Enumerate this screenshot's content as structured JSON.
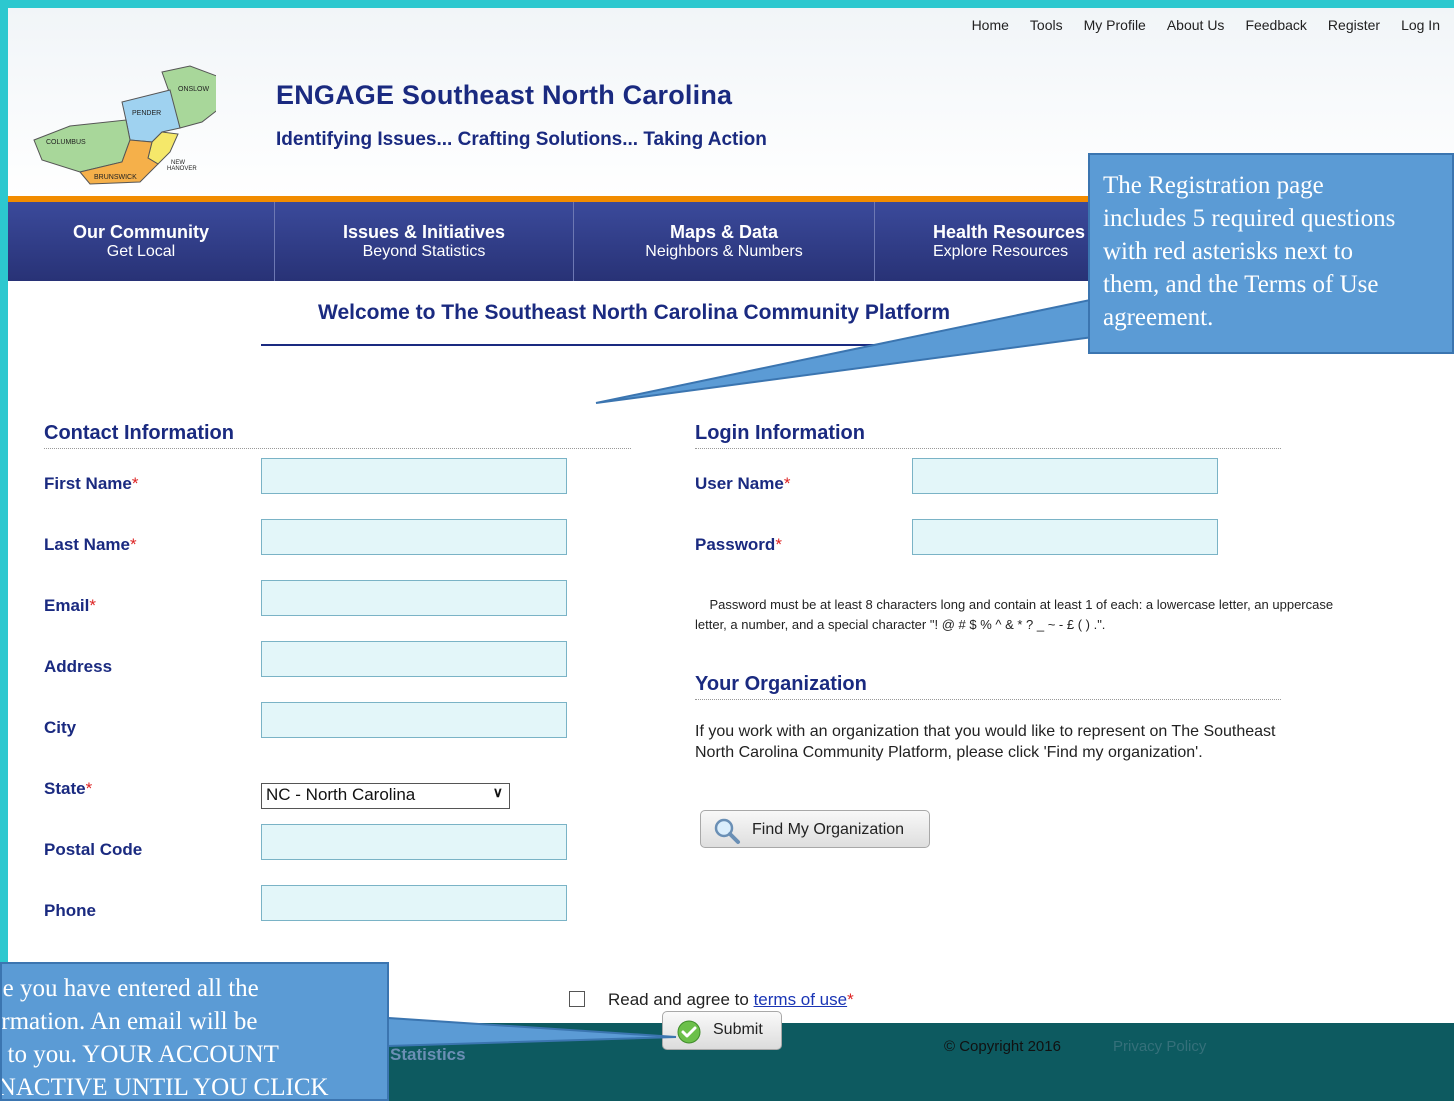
{
  "top_nav": [
    "Home",
    "Tools",
    "My Profile",
    "About Us",
    "Feedback",
    "Register",
    "Log In"
  ],
  "logo_map": {
    "counties": [
      "ONSLOW",
      "PENDER",
      "COLUMBUS",
      "NEW HANOVER",
      "BRUNSWICK"
    ],
    "county_ids": [
      "onslow",
      "pender",
      "columbus",
      "new-hanover",
      "brunswick"
    ]
  },
  "header": {
    "title": "ENGAGE Southeast North Carolina",
    "tagline": "Identifying Issues... Crafting Solutions... Taking Action"
  },
  "main_nav": [
    {
      "title": "Our Community",
      "subtitle": "Get Local"
    },
    {
      "title": "Issues & Initiatives",
      "subtitle": "Beyond Statistics"
    },
    {
      "title": "Maps & Data",
      "subtitle": "Neighbors & Numbers"
    },
    {
      "title": "Health Resources",
      "subtitle": "Explore Resources"
    }
  ],
  "nav_ids": [
    "our-community",
    "issues-initiatives",
    "maps-data",
    "health-resources"
  ],
  "welcome": "Welcome to The Southeast North Carolina Community Platform",
  "contact": {
    "heading": "Contact Information",
    "fields": [
      {
        "label": "First Name",
        "required": true,
        "value": ""
      },
      {
        "label": "Last Name",
        "required": true,
        "value": ""
      },
      {
        "label": "Email",
        "required": true,
        "value": ""
      },
      {
        "label": "Address",
        "required": false,
        "value": ""
      },
      {
        "label": "City",
        "required": false,
        "value": ""
      },
      {
        "label": "State",
        "required": true,
        "value": "NC - North Carolina"
      },
      {
        "label": "Postal Code",
        "required": false,
        "value": ""
      },
      {
        "label": "Phone",
        "required": false,
        "value": ""
      }
    ],
    "field_ids": [
      "first-name",
      "last-name",
      "email",
      "address",
      "city",
      "state",
      "postal-code",
      "phone"
    ]
  },
  "login": {
    "heading": "Login Information",
    "fields": [
      {
        "label": "User Name",
        "required": true,
        "value": ""
      },
      {
        "label": "Password",
        "required": true,
        "value": ""
      }
    ],
    "field_ids": [
      "user-name",
      "password"
    ],
    "password_note": "Password must be at least 8 characters long and contain at least 1 of each: a lowercase letter, an uppercase letter, a number, and a special character \"! @ # $ % ^ & * ? _ ~ - £ ( ) .\"."
  },
  "organization": {
    "heading": "Your Organization",
    "text": "If you work with an organization that you would like to represent on The Southeast North Carolina Community Platform, please click 'Find my organization'.",
    "button": "Find My Organization"
  },
  "terms": {
    "prefix": "Read and agree to ",
    "link": "terms of use",
    "required_mark": "*",
    "checked": false
  },
  "submit": "Submit",
  "required_mark": "*",
  "footer": {
    "left": "Statistics",
    "copyright": "© Copyright 2016",
    "privacy": "Privacy Policy"
  },
  "callouts": {
    "top_right": [
      "The Registration page",
      "includes 5 required questions",
      "with red  asterisks next to",
      "them, and the Terms of Use",
      "agreement."
    ],
    "bottom_left": [
      "Once you have entered all the",
      "information. An email will be",
      "sent to you. YOUR ACCOUNT",
      "IS INACTIVE UNTIL YOU CLICK"
    ]
  },
  "colors": {
    "navy": "#1a2a80",
    "orange": "#f28c00",
    "input_bg": "#e3f6f9",
    "callout": "#5b9bd5",
    "teal_frame": "#2cc8cf",
    "required": "#dd2222"
  }
}
